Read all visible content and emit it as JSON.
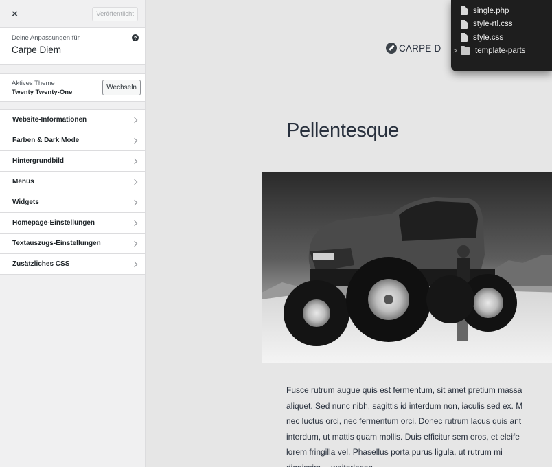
{
  "sidebar": {
    "close_label": "×",
    "publish_label": "Veröffentlicht",
    "info": {
      "pre": "Deine Anpassungen für",
      "title": "Carpe Diem",
      "help_glyph": "?"
    },
    "theme": {
      "label": "Aktives Theme",
      "name": "Twenty Twenty-One",
      "change_label": "Wechseln"
    },
    "items": [
      {
        "label": "Website-Informationen"
      },
      {
        "label": "Farben & Dark Mode"
      },
      {
        "label": "Hintergrundbild"
      },
      {
        "label": "Menüs"
      },
      {
        "label": "Widgets"
      },
      {
        "label": "Homepage-Einstellungen"
      },
      {
        "label": "Textauszugs-Einstellungen"
      },
      {
        "label": "Zusätzliches CSS"
      }
    ]
  },
  "preview": {
    "site_name": "CARPE D",
    "post_title": "Pellentesque",
    "excerpt_lines": [
      "Fusce rutrum augue quis est fermentum, sit amet pretium massa",
      "aliquet. Sed nunc nibh, sagittis id interdum non, iaculis sed ex. M",
      "nec luctus orci, nec fermentum orci. Donec rutrum lacus quis ant",
      "interdum, ut mattis quam mollis. Duis efficitur sem eros, et eleife",
      "lorem fringilla vel. Phasellus porta purus ligula, ut rutrum mi",
      "dignissim… weiterlesen"
    ]
  },
  "finder": {
    "files": [
      {
        "name": "single.php",
        "icon": "file-icon"
      },
      {
        "name": "style-rtl.css",
        "icon": "file-icon"
      },
      {
        "name": "style.css",
        "icon": "file-icon"
      }
    ],
    "folder": {
      "name": "template-parts",
      "chevron": ">",
      "icon": "folder-icon"
    }
  },
  "colors": {
    "sidebar_bg": "#f0f0f1",
    "preview_bg": "#e6e6e6",
    "finder_bg": "#1e1e1e",
    "text": "#1d2327"
  }
}
